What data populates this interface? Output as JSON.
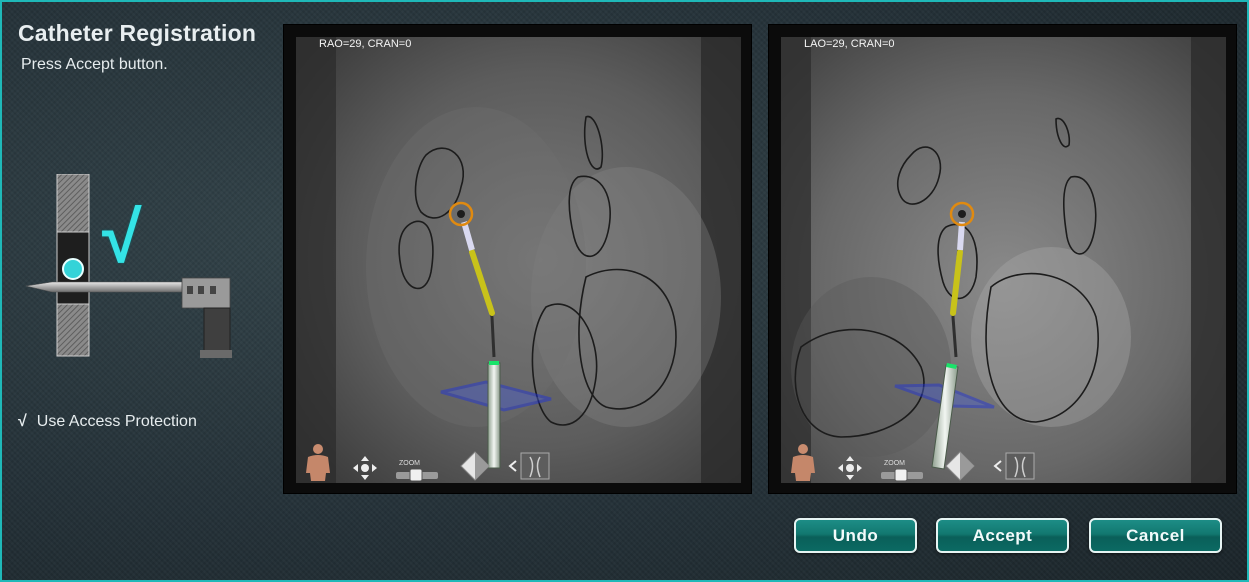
{
  "panel": {
    "title": "Catheter Registration",
    "instruction": "Press Accept button.",
    "access_protection_check": "√",
    "access_protection_label": "Use Access Protection",
    "big_check": "√"
  },
  "views": [
    {
      "label": "RAO=29, CRAN=0"
    },
    {
      "label": "LAO=29, CRAN=0"
    }
  ],
  "toolbar": {
    "zoom_label": "ZOOM"
  },
  "buttons": {
    "undo": "Undo",
    "accept": "Accept",
    "cancel": "Cancel"
  },
  "colors": {
    "accent": "#1fb8b8",
    "check": "#34e3e6",
    "button": "#127870",
    "plane": "#1a2fe0",
    "catheter": "#c8c21a",
    "target_ring": "#e08a10"
  }
}
